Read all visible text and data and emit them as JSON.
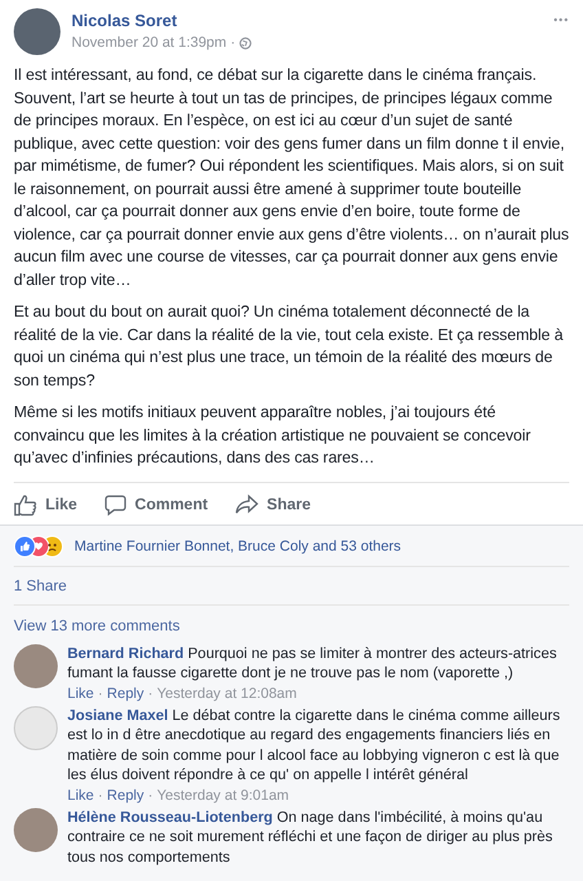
{
  "post": {
    "author": "Nicolas Soret",
    "timestamp": "November 20 at 1:39pm",
    "separator": "·",
    "more": "•••",
    "paragraphs": [
      "Il est intéressant, au fond, ce débat sur la cigarette dans le cinéma français. Souvent, l’art se heurte à tout un tas de principes, de principes légaux comme de principes moraux. En l’espèce, on est ici au cœur d’un sujet de santé publique, avec cette question: voir des gens fumer dans un film donne t il envie, par mimétisme, de fumer? Oui répondent les scientifiques. Mais alors, si on suit le raisonnement, on pourrait aussi être amené à supprimer toute bouteille d’alcool, car ça pourrait donner aux gens envie d’en boire, toute forme de violence, car ça pourrait donner envie aux gens d’être violents… on n’aurait plus aucun film avec une course de vitesses, car ça pourrait donner aux gens envie d’aller trop vite…",
      "Et au bout du bout on aurait quoi? Un cinéma totalement déconnecté de la réalité de la vie. Car dans la réalité de la vie, tout cela existe. Et ça ressemble à quoi un cinéma qui n’est plus une trace, un témoin de la réalité des mœurs de son temps?",
      "Même si les motifs initiaux peuvent apparaître nobles, j’ai toujours été convaincu que les limites à la création artistique ne pouvaient se concevoir qu’avec d’infinies précautions, dans des cas rares…"
    ]
  },
  "actions": [
    {
      "kind": "like",
      "label": "Like"
    },
    {
      "kind": "comment",
      "label": "Comment"
    },
    {
      "kind": "share",
      "label": "Share"
    }
  ],
  "reactions": {
    "text": "Martine Fournier Bonnet, Bruce Coly and 53 others"
  },
  "shares": "1 Share",
  "view_more": "View 13 more comments",
  "comment_separator": "·",
  "comments": [
    {
      "author": "Bernard Richard",
      "text": "Pourquoi ne pas se limiter à montrer des acteurs-atrices fumant la fausse cigarette dont je ne trouve pas le nom (vaporette ,)",
      "actions": [
        "Like",
        "Reply"
      ],
      "time": "Yesterday at 12:08am"
    },
    {
      "author": "Josiane Maxel",
      "text": "Le débat contre la cigarette dans le cinéma comme ailleurs est lo in d être anecdotique au regard des engagements financiers liés en matière de soin comme pour l alcool face au lobbying vigneron c est là que les élus doivent répondre à ce qu' on appelle l intérêt général",
      "actions": [
        "Like",
        "Reply"
      ],
      "time": "Yesterday at 9:01am"
    },
    {
      "author": "Hélène Rousseau-Liotenberg",
      "text": "On nage dans l'imbécilité, à moins qu'au contraire ce ne soit murement réfléchi et une façon de diriger au plus près tous nos comportements"
    }
  ]
}
